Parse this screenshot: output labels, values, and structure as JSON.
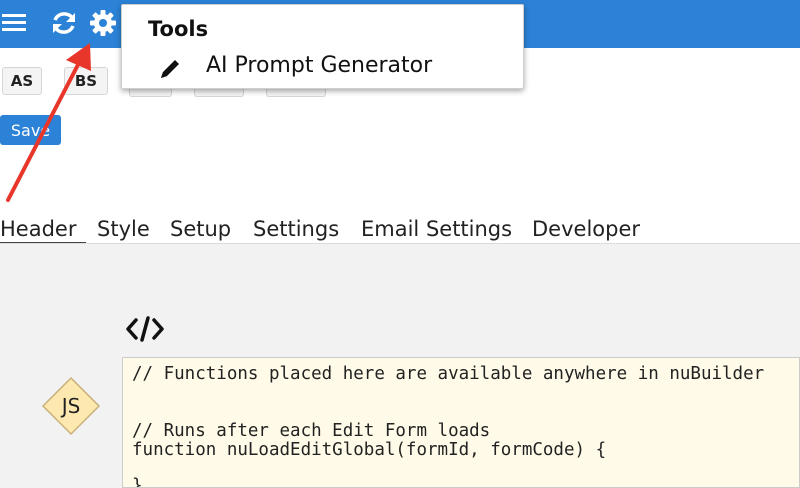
{
  "tools_menu": {
    "title": "Tools",
    "items": [
      {
        "label": "AI Prompt Generator",
        "icon": "pencil-icon"
      }
    ]
  },
  "toolbar": {
    "icons": [
      "menu-icon",
      "refresh-icon",
      "gear-icon"
    ]
  },
  "buttons": {
    "as_label": "AS",
    "bs_label": "BS",
    "save_label": "Save"
  },
  "tabs": [
    {
      "label": "Header",
      "active": true
    },
    {
      "label": "Style",
      "active": false
    },
    {
      "label": "Setup",
      "active": false
    },
    {
      "label": "Settings",
      "active": false
    },
    {
      "label": "Email Settings",
      "active": false
    },
    {
      "label": "Developer",
      "active": false
    }
  ],
  "section": {
    "code_icon": "code-icon",
    "badge_label": "JS"
  },
  "editor": {
    "lines": [
      "// Functions placed here are available anywhere in nuBuilder",
      "",
      "",
      "// Runs after each Edit Form loads",
      "function nuLoadEditGlobal(formId, formCode) {",
      "",
      "}"
    ]
  },
  "colors": {
    "topbar": "#2b82d6",
    "save_button": "#2b82d6",
    "annotation_arrow": "#e8372a",
    "badge_fill": "#fde9b0",
    "editor_bg": "#fffbe8"
  }
}
